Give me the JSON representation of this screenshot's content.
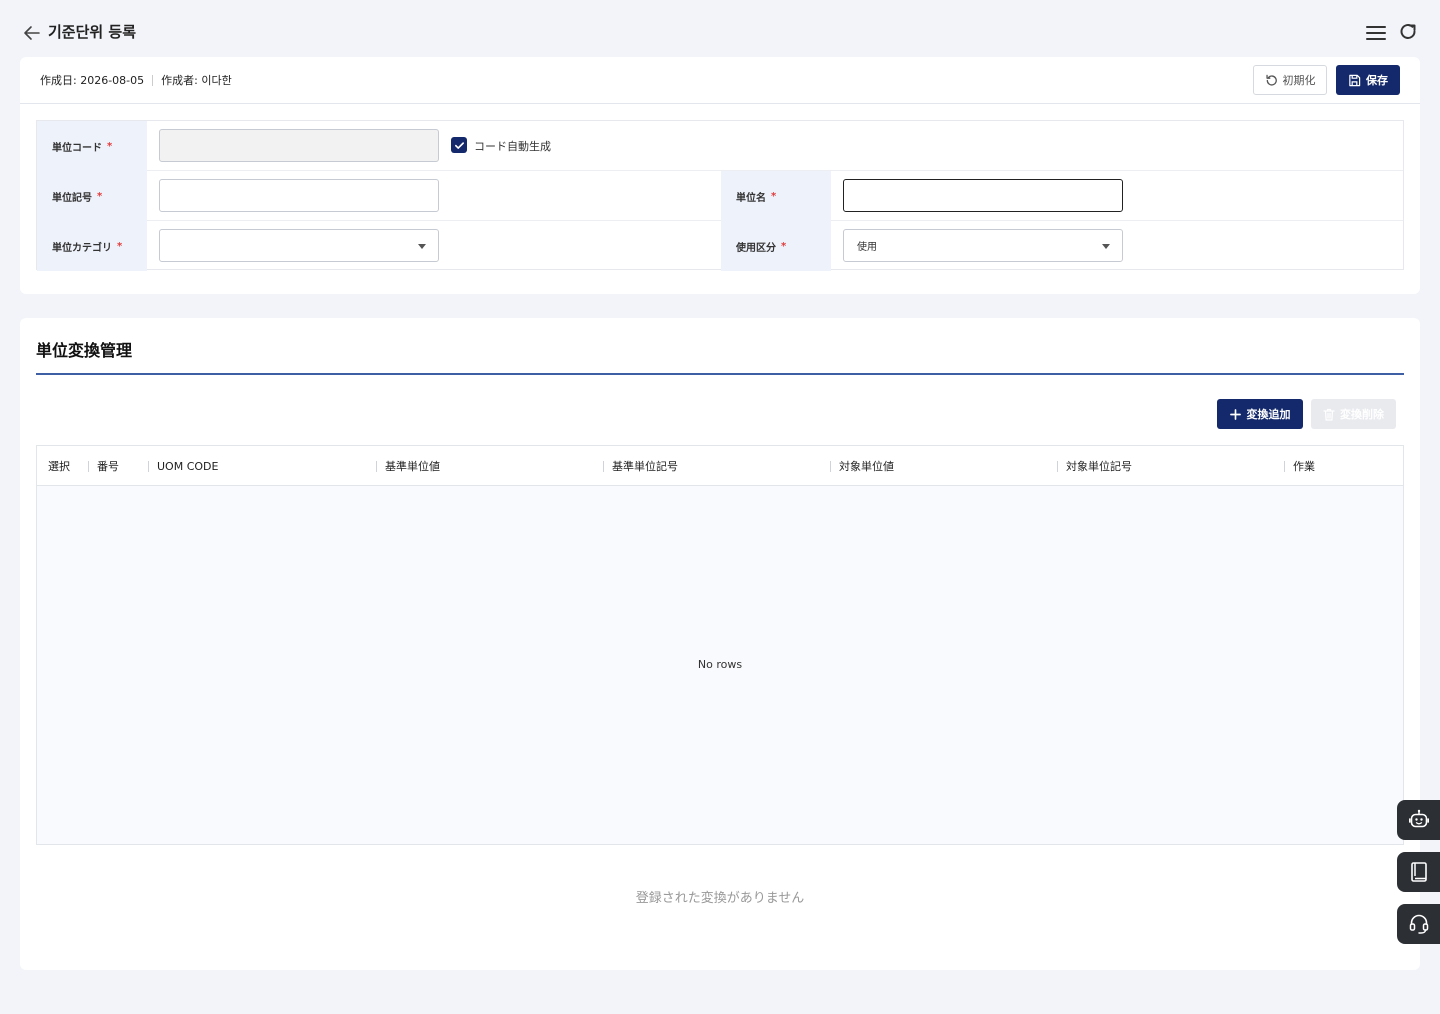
{
  "header": {
    "title": "기준단위 등록",
    "icons": {
      "back": "arrow-left-icon",
      "menu": "hamburger-menu-icon",
      "refresh": "refresh-icon"
    }
  },
  "meta": {
    "created_date_label": "作成日:",
    "created_date": "2026-08-05",
    "author_label": "作成者:",
    "author": "이다한"
  },
  "toolbar": {
    "reset_label": "初期化",
    "save_label": "保存"
  },
  "form": {
    "unit_code": {
      "label": "単位コード",
      "value": "",
      "disabled": true
    },
    "auto_generate": {
      "label": "コード自動生成",
      "checked": true
    },
    "unit_symbol": {
      "label": "単位記号",
      "value": ""
    },
    "unit_name": {
      "label": "単位名",
      "value": ""
    },
    "unit_category": {
      "label": "単位カテゴリ",
      "value": ""
    },
    "usage": {
      "label": "使用区分",
      "value": "使用"
    },
    "required_mark": "*"
  },
  "conversion": {
    "title": "単位変換管理",
    "add_label": "変換追加",
    "delete_label": "変換削除",
    "columns": [
      "選択",
      "番号",
      "UOM CODE",
      "基準単位値",
      "基準単位記号",
      "対象単位値",
      "対象単位記号",
      "作業"
    ],
    "rows": [],
    "no_rows_text": "No rows",
    "empty_message": "登録された変換がありません"
  },
  "colors": {
    "primary": "#13296b",
    "accent_line": "#3f5fa5",
    "label_bg": "#eef2fb",
    "required": "#e23b3b",
    "page_bg": "#f2f4f9"
  },
  "floating": {
    "icons": [
      "chatbot-icon",
      "manual-book-icon",
      "support-headset-icon"
    ]
  }
}
